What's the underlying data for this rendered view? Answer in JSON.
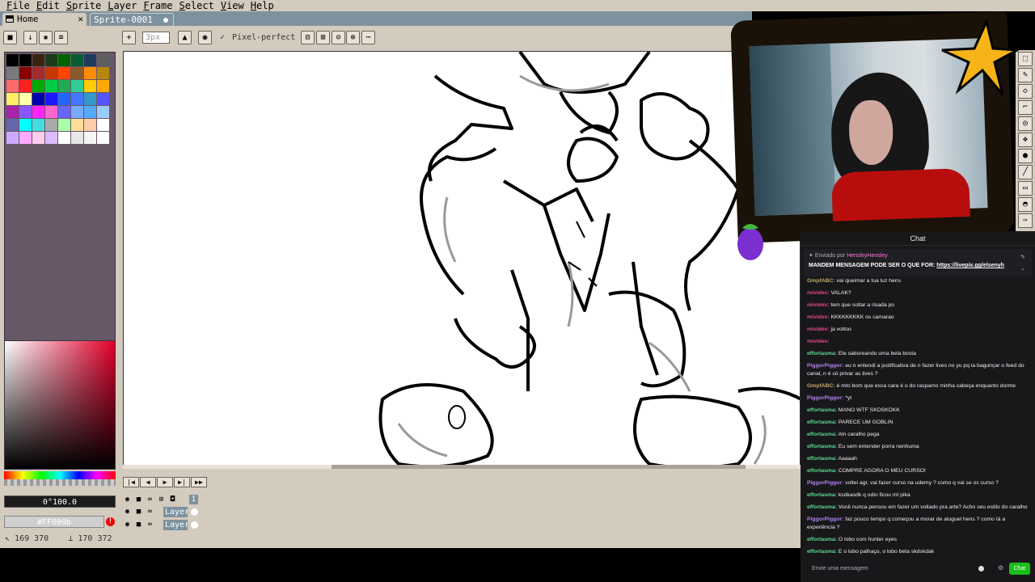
{
  "menubar": {
    "items": [
      "File",
      "Edit",
      "Sprite",
      "Layer",
      "Frame",
      "Select",
      "View",
      "Help"
    ]
  },
  "tabs": [
    {
      "label": "Home",
      "active": true
    },
    {
      "label": "Sprite-0001",
      "active": false
    }
  ],
  "toolbar": {
    "brush_size_placeholder": "3px",
    "pixel_perfect_label": "Pixel-perfect",
    "pixel_perfect_checked": true
  },
  "palette": {
    "colors": [
      "#000000",
      "#000000",
      "#3a2410",
      "#1a3d1a",
      "#006400",
      "#0a5c33",
      "#1f3c5e",
      "#5e5e5e",
      "#7a7a7a",
      "#8b0000",
      "#a52a2a",
      "#c63800",
      "#ff4500",
      "#8b5a2b",
      "#ff8c00",
      "#b8860b",
      "#ff6a6a",
      "#ff2020",
      "#00aa00",
      "#00cc44",
      "#22aa55",
      "#33cc99",
      "#ffcc00",
      "#ffaa00",
      "#ffee66",
      "#ffffaa",
      "#0000aa",
      "#1a1aff",
      "#2266ff",
      "#4477ff",
      "#3399cc",
      "#5555ff",
      "#aa22aa",
      "#8855ff",
      "#ff22ff",
      "#ff66cc",
      "#6666ff",
      "#77aaff",
      "#55aaff",
      "#99ccff",
      "#6666aa",
      "#00ffff",
      "#44dddd",
      "#aaaaaa",
      "#aaffaa",
      "#ffdd99",
      "#ffccaa",
      "#ffffff",
      "#ccaaff",
      "#ffaaff",
      "#ffccee",
      "#ddbbff",
      "#ffffff",
      "#e8e8e8",
      "#f5f5f5",
      "#ffffff"
    ]
  },
  "color_picker": {
    "value_text": "0°100.0",
    "hex_text": "#FF009b",
    "spectrum_color": "#e1002b"
  },
  "timeline": {
    "buttons": [
      "first-frame",
      "prev-frame",
      "play",
      "next-frame",
      "last-frame"
    ],
    "frame_number": "1",
    "layers": [
      {
        "name": "Layer"
      },
      {
        "name": "Layer"
      }
    ]
  },
  "status": {
    "coords": "169 370",
    "size": "170 372"
  },
  "chat": {
    "header": "Chat",
    "pinned": {
      "sent_by_label": "Enviado por",
      "user": "HensleyHensley",
      "text": "MANDEM MENSAGEM PODE SER O QUE FOR:",
      "link": "https://livepix.gg/elsenyh"
    },
    "messages": [
      {
        "user": "GmpfABC:",
        "color": "#c0a86a",
        "text": " vai queimar a tua luz hens"
      },
      {
        "user": "mividev:",
        "color": "#e4478a",
        "text": " VALAK?"
      },
      {
        "user": "mividev:",
        "color": "#e4478a",
        "text": " tem que soltar a risada po"
      },
      {
        "user": "mividev:",
        "color": "#e4478a",
        "text": " KKKKKKKKK os camarao"
      },
      {
        "user": "mividev:",
        "color": "#e4478a",
        "text": " ja voltoo"
      },
      {
        "user": "mividev:",
        "color": "#e4478a",
        "text": " "
      },
      {
        "user": "effortasma:",
        "color": "#5fd98e",
        "text": " Ele saboreando uma bela bosta"
      },
      {
        "user": "PiggorPiggor:",
        "color": "#b281ee",
        "text": " eu n entendi a justificativa de n fazer lives no yu pq ia bagunçar o feed do canal, n é só privar as lives ?"
      },
      {
        "user": "GmpfABC:",
        "color": "#c0a86a",
        "text": " é mto bom que essa cara é o do raspamo minha cabeça enquanto dorme"
      },
      {
        "user": "PiggorPiggor:",
        "color": "#b281ee",
        "text": " *yt"
      },
      {
        "user": "effortasma:",
        "color": "#5fd98e",
        "text": " MANO WTF SKDSKDKK"
      },
      {
        "user": "effortasma:",
        "color": "#5fd98e",
        "text": " PARECE UM GOBLIN"
      },
      {
        "user": "effortasma:",
        "color": "#5fd98e",
        "text": " Aln caralho pega"
      },
      {
        "user": "effortasma:",
        "color": "#5fd98e",
        "text": " Eu sem entender porra nenhuma"
      },
      {
        "user": "effortasma:",
        "color": "#5fd98e",
        "text": " Aaaaah"
      },
      {
        "user": "effortasma:",
        "color": "#5fd98e",
        "text": " COMPRE AGORA O MEU CURSO!"
      },
      {
        "user": "PiggorPiggor:",
        "color": "#b281ee",
        "text": " voltei agr, vai fazer curso na udemy ? como q vai se os curso ?"
      },
      {
        "user": "effortasma:",
        "color": "#5fd98e",
        "text": " ksdkasdk q odio ficou mt pika"
      },
      {
        "user": "effortasma:",
        "color": "#5fd98e",
        "text": " Você nunca pensou em fazer um voltado pra arte? Acho seu estilo do caralho"
      },
      {
        "user": "PiggorPiggor:",
        "color": "#b281ee",
        "text": " faz pouco tempo q começou a morar de aluguel hens ? como tá a experiência ?"
      },
      {
        "user": "effortasma:",
        "color": "#5fd98e",
        "text": " O lobo com hunter eyes"
      },
      {
        "user": "effortasma:",
        "color": "#5fd98e",
        "text": " E o lobo palhaço, o lobo beta skdskdak"
      }
    ],
    "input_placeholder": "Envie uma mensagem",
    "send_label": "Chat"
  }
}
